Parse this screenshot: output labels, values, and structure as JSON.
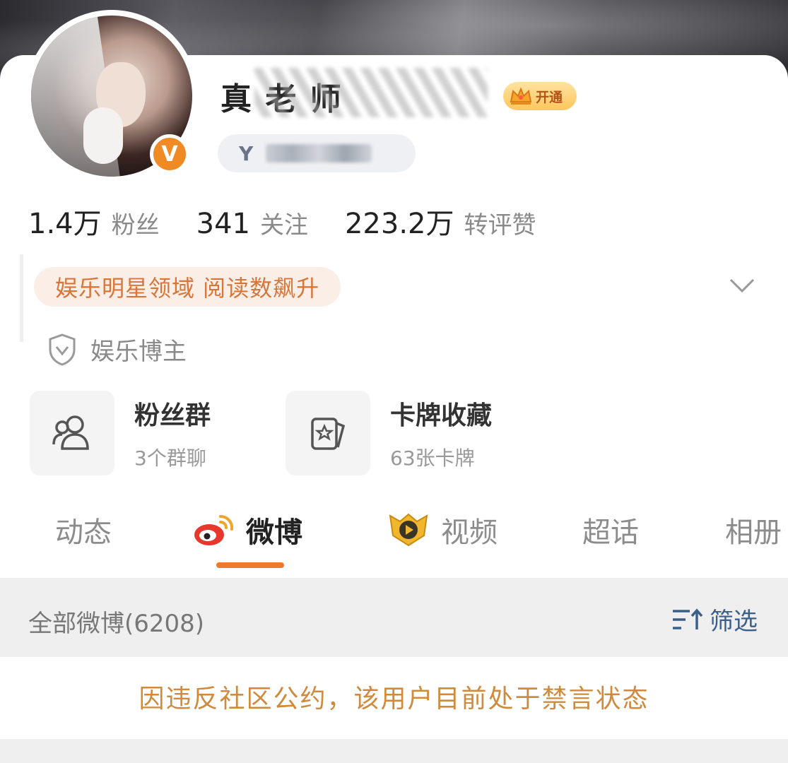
{
  "profile": {
    "name": "真 老 师",
    "vip_label": "开通",
    "verified_mark": "V"
  },
  "stats": [
    {
      "value": "1.4万",
      "label": "粉丝"
    },
    {
      "value": "341",
      "label": "关注"
    },
    {
      "value": "223.2万",
      "label": "转评赞"
    }
  ],
  "domain_tag": "娱乐明星领域 阅读数飙升",
  "role": "娱乐博主",
  "features": [
    {
      "title": "粉丝群",
      "subtitle": "3个群聊",
      "icon": "people-icon"
    },
    {
      "title": "卡牌收藏",
      "subtitle": "63张卡牌",
      "icon": "card-icon"
    }
  ],
  "tabs": [
    {
      "label": "动态",
      "active": false
    },
    {
      "label": "微博",
      "active": true,
      "icon": "weibo-logo-icon"
    },
    {
      "label": "视频",
      "active": false,
      "icon": "video-play-icon"
    },
    {
      "label": "超话",
      "active": false
    },
    {
      "label": "相册",
      "active": false
    }
  ],
  "feed": {
    "count_label": "全部微博(6208)",
    "filter_label": "筛选"
  },
  "notice": "因违反社区公约，该用户目前处于禁言状态",
  "colors": {
    "accent": "#f07a2b",
    "tag_text": "#d8763a",
    "notice_text": "#d08a3e",
    "filter_text": "#3a5f8a",
    "verified_badge": "#f08a24"
  }
}
